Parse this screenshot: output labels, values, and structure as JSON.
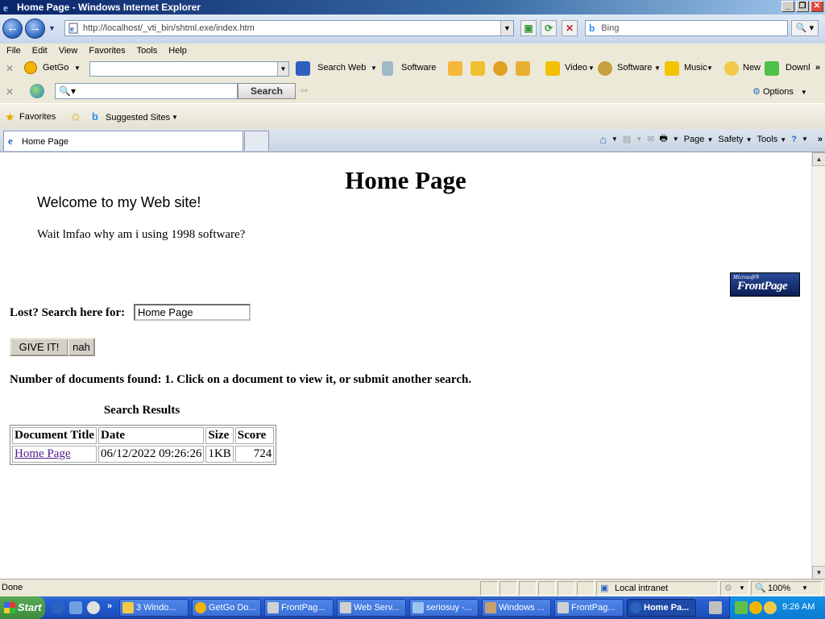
{
  "window": {
    "title": "Home Page - Windows Internet Explorer",
    "controls": {
      "minimize": "_",
      "maximize": "❐",
      "close": "✕"
    }
  },
  "address": {
    "url": "http://localhost/_vti_bin/shtml.exe/index.htm",
    "search_placeholder": "Bing"
  },
  "menu": [
    "File",
    "Edit",
    "View",
    "Favorites",
    "Tools",
    "Help"
  ],
  "getgo_toolbar": {
    "brand": "GetGo",
    "items": [
      "Search Web",
      "Software",
      "Video",
      "Software",
      "Music",
      "New",
      "Downl"
    ]
  },
  "search_toolbar": {
    "button": "Search",
    "options": "Options"
  },
  "favorites_bar": {
    "favorites": "Favorites",
    "suggested": "Suggested Sites"
  },
  "tabs": {
    "active": "Home Page"
  },
  "command_bar": [
    "Page",
    "Safety",
    "Tools"
  ],
  "page": {
    "heading": "Home Page",
    "welcome": "Welcome to my Web site!",
    "wait_text": "Wait lmfao why am i using 1998 software?",
    "logo": {
      "small": "Microsoft®",
      "big": "FrontPage"
    },
    "search_label": "Lost? Search here for:",
    "search_value": "Home Page",
    "submit_button": "GIVE IT!",
    "reset_button": "nah",
    "docs_found": "Number of documents found: 1. Click on a document to view it, or submit another search.",
    "results_caption": "Search Results",
    "results_headers": [
      "Document Title",
      "Date",
      "Size",
      "Score"
    ],
    "results_rows": [
      {
        "title": "Home Page",
        "date": "06/12/2022 09:26:26",
        "size": "1KB",
        "score": "724"
      }
    ]
  },
  "status": {
    "text": "Done",
    "zone": "Local intranet",
    "zoom": "100%"
  },
  "taskbar": {
    "start": "Start",
    "buttons": [
      "3 Windo...",
      "GetGo Do...",
      "FrontPag...",
      "Web Serv...",
      "seriosuy -...",
      "Windows ...",
      "FrontPag...",
      "Home Pa..."
    ],
    "clock": "9:26 AM"
  }
}
